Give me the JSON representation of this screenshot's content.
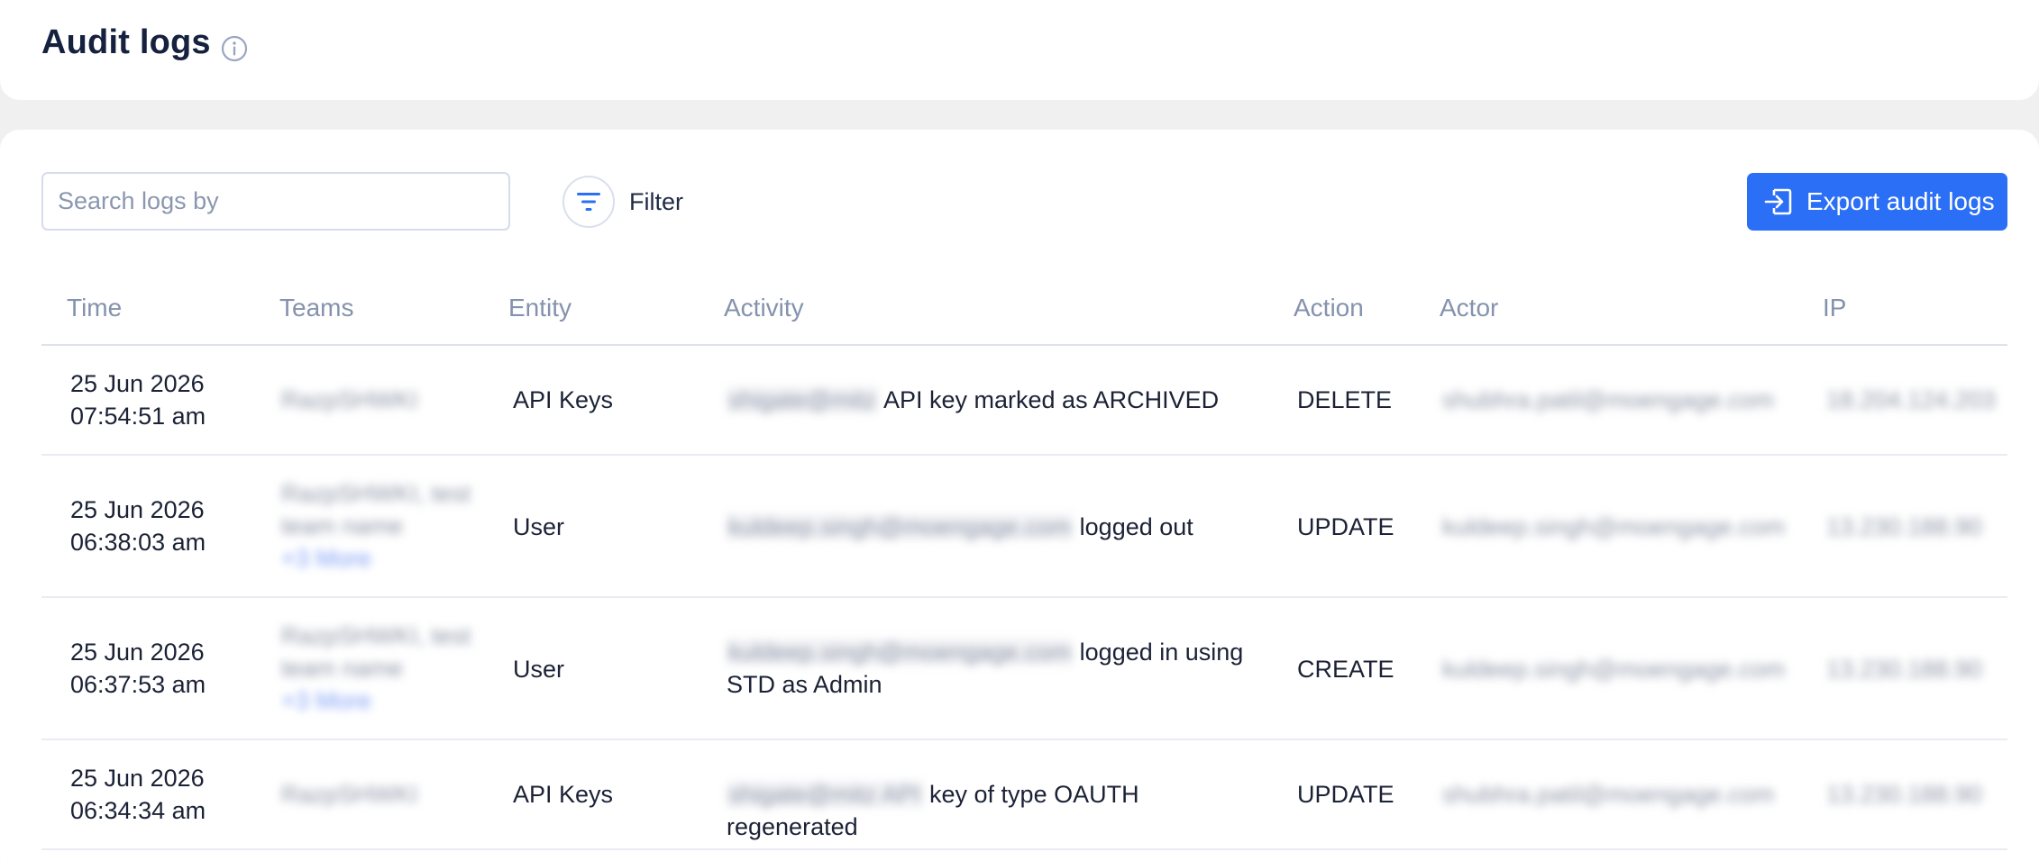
{
  "header": {
    "title": "Audit logs",
    "info_icon": "info-icon"
  },
  "toolbar": {
    "search_placeholder": "Search logs by",
    "filter_label": "Filter",
    "filter_icon": "filter-icon",
    "export_label": "Export audit logs",
    "export_icon": "export-icon",
    "accent_color": "#2b6ff6"
  },
  "table": {
    "columns": [
      "Time",
      "Teams",
      "Entity",
      "Activity",
      "Action",
      "Actor",
      "IP"
    ],
    "rows": [
      {
        "date": "25 Jun 2026",
        "time": "07:54:51 am",
        "teams_line1": "RazpSHWKI",
        "teams_line2": "",
        "teams_more": "",
        "entity": "API Keys",
        "activity_subject": "shigate@mitz",
        "activity_text": "API key marked as ARCHIVED",
        "activity_text2": "",
        "action": "DELETE",
        "actor": "shubhra.patil@moengage.com",
        "ip": "18.204.124.203"
      },
      {
        "date": "25 Jun 2026",
        "time": "06:38:03 am",
        "teams_line1": "RazpSHWKI, test",
        "teams_line2": "team name",
        "teams_more": "+3 More",
        "entity": "User",
        "activity_subject": "kuldeep.singh@moengage.com",
        "activity_text": "logged out",
        "activity_text2": "",
        "action": "UPDATE",
        "actor": "kuldeep.singh@moengage.com",
        "ip": "13.230.188.90"
      },
      {
        "date": "25 Jun 2026",
        "time": "06:37:53 am",
        "teams_line1": "RazpSHWKI, test",
        "teams_line2": "team name",
        "teams_more": "+3 More",
        "entity": "User",
        "activity_subject": "kuldeep.singh@moengage.com",
        "activity_text": "logged in using",
        "activity_text2": "STD as Admin",
        "action": "CREATE",
        "actor": "kuldeep.singh@moengage.com",
        "ip": "13.230.188.90"
      },
      {
        "date": "25 Jun 2026",
        "time": "06:34:34 am",
        "teams_line1": "RazpSHWKI",
        "teams_line2": "",
        "teams_more": "",
        "entity": "API Keys",
        "activity_subject": "shigate@mitz API",
        "activity_text": "key of type OAUTH regenerated",
        "activity_text2": "",
        "action": "UPDATE",
        "actor": "shubhra.patil@moengage.com",
        "ip": "13.230.188.90"
      }
    ]
  }
}
